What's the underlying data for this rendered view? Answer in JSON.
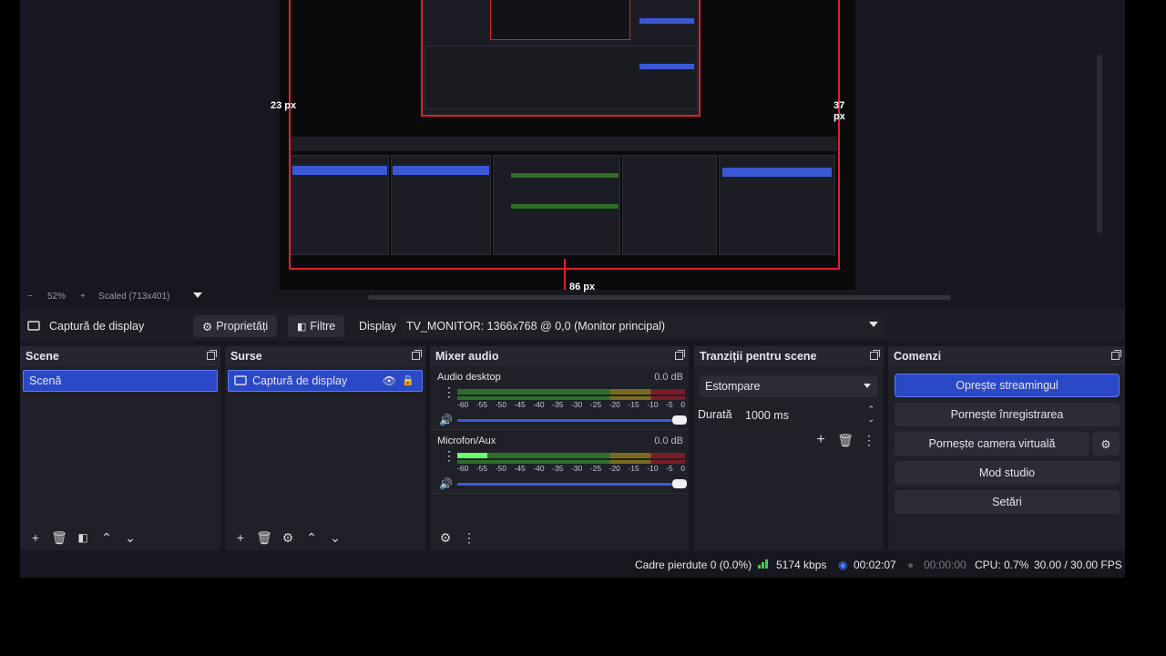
{
  "preview": {
    "labels": {
      "left": "23 px",
      "right": "37 px",
      "bottom": "86 px"
    },
    "zoom_value": "52%",
    "scaled_text": "Scaled (713x401)"
  },
  "source_toolbar": {
    "source_name": "Captură de display",
    "properties_label": "Proprietăți",
    "filters_label": "Filtre",
    "display_label": "Display",
    "display_value": "TV_MONITOR: 1366x768 @ 0,0 (Monitor principal)"
  },
  "scenes": {
    "title": "Scene",
    "items": [
      {
        "label": "Scenă",
        "selected": true
      }
    ]
  },
  "sources": {
    "title": "Surse",
    "items": [
      {
        "label": "Captură de display",
        "visible": true,
        "locked": true
      }
    ]
  },
  "mixer": {
    "title": "Mixer audio",
    "channels": [
      {
        "name": "Audio desktop",
        "db": "0.0 dB",
        "level": 0.0
      },
      {
        "name": "Microfon/Aux",
        "db": "0.0 dB",
        "level": 0.13
      }
    ],
    "ticks": [
      "-60",
      "-55",
      "-50",
      "-45",
      "-40",
      "-35",
      "-30",
      "-25",
      "-20",
      "-15",
      "-10",
      "-5",
      "0"
    ]
  },
  "transitions": {
    "title": "Tranziții pentru scene",
    "type_value": "Estompare",
    "duration_label": "Durată",
    "duration_value": "1000 ms"
  },
  "controls": {
    "title": "Comenzi",
    "stop_stream": "Oprește streamingul",
    "start_recording": "Pornește înregistrarea",
    "start_virtual_cam": "Pornește camera virtuală",
    "studio_mode": "Mod studio",
    "settings": "Setări"
  },
  "status": {
    "dropped_frames": "Cadre pierdute 0 (0.0%)",
    "bitrate": "5174 kbps",
    "stream_time": "00:02:07",
    "rec_time": "00:00:00",
    "cpu": "CPU: 0.7%",
    "fps": "30.00 / 30.00 FPS"
  },
  "colors": {
    "accent": "#2b48c6",
    "bounds_red": "#e21f2b",
    "bg": "#17181f",
    "panel": "#1f2028"
  }
}
